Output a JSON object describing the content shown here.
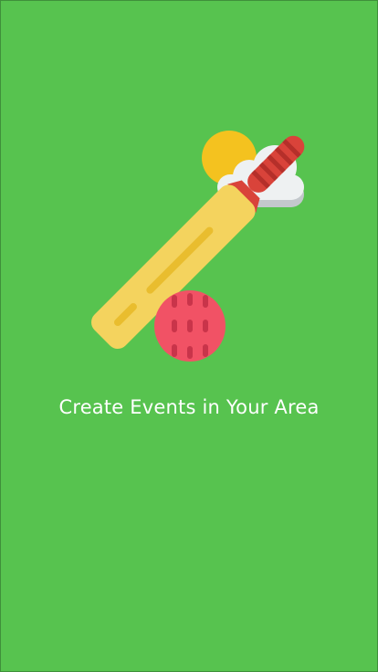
{
  "onboarding": {
    "headline": "Create Events in Your Area"
  },
  "illustration": {
    "icons": [
      "cricket-bat-icon",
      "cricket-ball-icon",
      "sun-icon",
      "cloud-icon"
    ]
  },
  "colors": {
    "background": "#57c34f",
    "bat_blade": "#f4d35e",
    "bat_groove": "#e9bd2e",
    "bat_handle": "#d9433a",
    "bat_grip_stripe": "#b52f2a",
    "ball": "#f15265",
    "ball_seam": "#c9344a",
    "sun": "#f4c21f",
    "cloud": "#eef1f2",
    "cloud_shadow": "#c3c8cc",
    "text": "#ffffff"
  }
}
